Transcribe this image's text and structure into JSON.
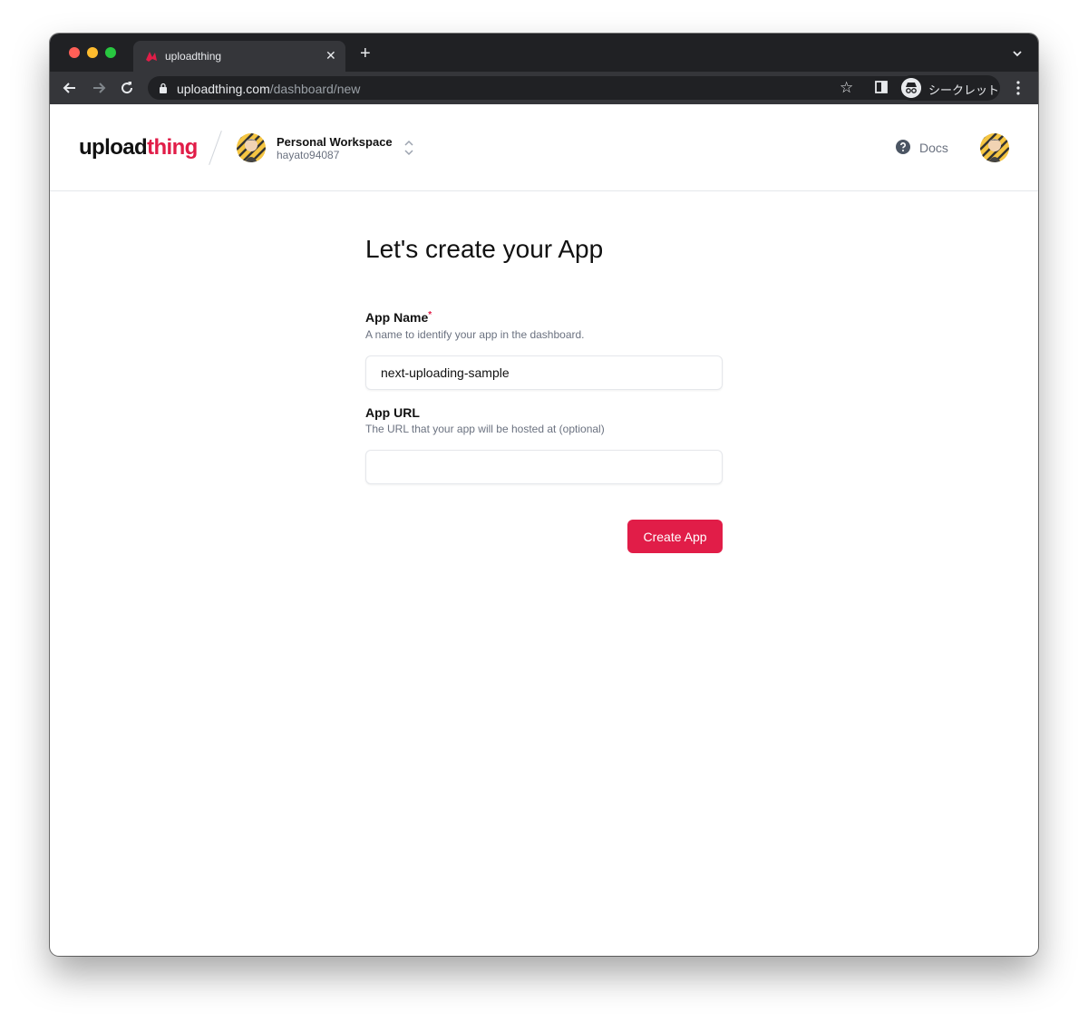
{
  "browser": {
    "tab_title": "uploadthing",
    "url_host": "uploadthing.com",
    "url_path": "/dashboard/new",
    "incognito_label": "シークレット"
  },
  "header": {
    "logo_main": "upload",
    "logo_accent": "thing",
    "workspace_name": "Personal Workspace",
    "workspace_user": "hayato94087",
    "docs_label": "Docs"
  },
  "form": {
    "title": "Let's create your App",
    "app_name_label": "App Name",
    "app_name_required": "*",
    "app_name_desc": "A name to identify your app in the dashboard.",
    "app_name_value": "next-uploading-sample",
    "app_url_label": "App URL",
    "app_url_desc": "The URL that your app will be hosted at (optional)",
    "app_url_value": "",
    "submit_label": "Create App"
  },
  "colors": {
    "accent": "#e11d48",
    "annotation_arrow": "#f43f6e"
  }
}
